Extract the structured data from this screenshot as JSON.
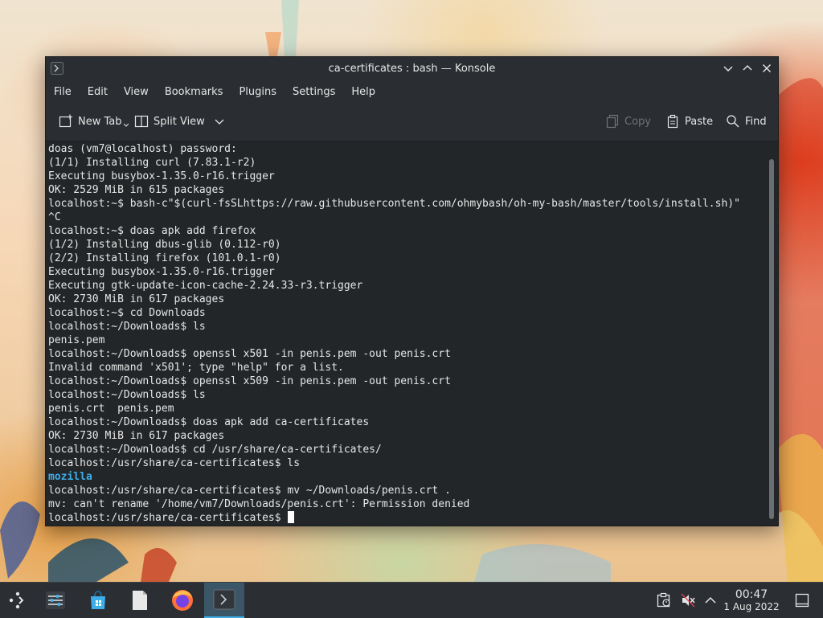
{
  "window": {
    "title": "ca-certificates : bash — Konsole"
  },
  "menu": [
    "File",
    "Edit",
    "View",
    "Bookmarks",
    "Plugins",
    "Settings",
    "Help"
  ],
  "toolbar": {
    "new_tab": "New Tab",
    "split_view": "Split View",
    "copy": "Copy",
    "paste": "Paste",
    "find": "Find"
  },
  "terminal": {
    "lines": [
      "doas (vm7@localhost) password:",
      "(1/1) Installing curl (7.83.1-r2)",
      "Executing busybox-1.35.0-r16.trigger",
      "OK: 2529 MiB in 615 packages",
      "localhost:~$ bash-c\"$(curl-fsSLhttps://raw.githubusercontent.com/ohmybash/oh-my-bash/master/tools/install.sh)\"",
      "^C",
      "localhost:~$ doas apk add firefox",
      "(1/2) Installing dbus-glib (0.112-r0)",
      "(2/2) Installing firefox (101.0.1-r0)",
      "Executing busybox-1.35.0-r16.trigger",
      "Executing gtk-update-icon-cache-2.24.33-r3.trigger",
      "OK: 2730 MiB in 617 packages",
      "localhost:~$ cd Downloads",
      "localhost:~/Downloads$ ls",
      "penis.pem",
      "localhost:~/Downloads$ openssl x501 -in penis.pem -out penis.crt",
      "Invalid command 'x501'; type \"help\" for a list.",
      "localhost:~/Downloads$ openssl x509 -in penis.pem -out penis.crt",
      "localhost:~/Downloads$ ls",
      "penis.crt  penis.pem",
      "localhost:~/Downloads$ doas apk add ca-certificates",
      "OK: 2730 MiB in 617 packages",
      "localhost:~/Downloads$ cd /usr/share/ca-certificates/",
      "localhost:/usr/share/ca-certificates$ ls",
      "mozilla",
      "localhost:/usr/share/ca-certificates$ mv ~/Downloads/penis.crt .",
      "mv: can't rename '/home/vm7/Downloads/penis.crt': Permission denied",
      "localhost:/usr/share/ca-certificates$ "
    ]
  },
  "taskbar": {
    "apps": [
      "application-launcher-icon",
      "settings-icon",
      "discover-store-icon",
      "file-icon",
      "firefox-icon",
      "konsole-icon"
    ],
    "clock_time": "00:47",
    "clock_date": "1 Aug 2022"
  },
  "colors": {
    "accent": "#3daee9",
    "terminal_bg": "#232629",
    "terminal_fg": "#e6e6e6",
    "window_chrome": "#2a2e32",
    "taskbar_bg": "#2b2e33"
  }
}
